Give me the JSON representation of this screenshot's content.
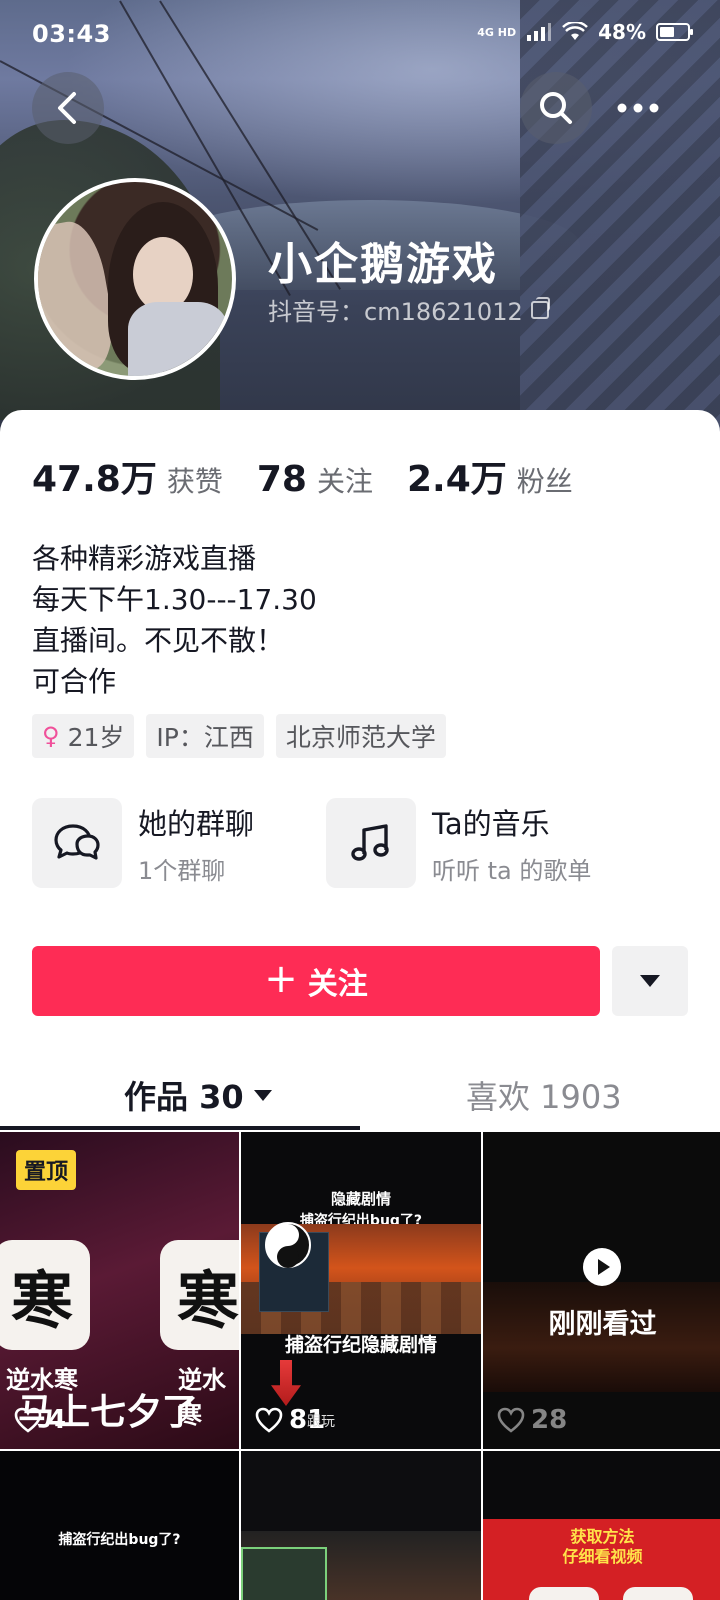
{
  "status_bar": {
    "time": "03:43",
    "network": "4G HD",
    "battery": "48%"
  },
  "profile": {
    "name": "小企鹅游戏",
    "handle": "抖音号：cm18621012"
  },
  "stats": [
    {
      "value": "47.8万",
      "label": "获赞"
    },
    {
      "value": "78",
      "label": "关注"
    },
    {
      "value": "2.4万",
      "label": "粉丝"
    }
  ],
  "bio": {
    "line1": "各种精彩游戏直播",
    "line2": "每天下午1.30---17.30",
    "line3": "直播间。不见不散！",
    "line4": "可合作"
  },
  "tags": {
    "age": "21岁",
    "ip": "IP：江西",
    "school": "北京师范大学"
  },
  "features": {
    "group_title": "她的群聊",
    "group_sub": "1个群聊",
    "music_title": "Ta的音乐",
    "music_sub": "听听 ta 的歌单"
  },
  "actions": {
    "follow": "关注"
  },
  "tabs": {
    "works": "作品 30",
    "likes": "喜欢 1903"
  },
  "grid": {
    "cell1": {
      "pin": "置顶",
      "app_glyph": "寒",
      "app_name_left": "逆水寒",
      "app_name_right": "逆水寒",
      "caption": "马上七夕了",
      "likes": "4"
    },
    "cell2": {
      "title_line1": "隐藏剧情",
      "title_line2": "捕盗行纪出bug了?",
      "subtitle": "捕盗行纪隐藏剧情",
      "likes": "81",
      "small_text": "跟玩"
    },
    "cell3": {
      "label": "刚刚看过",
      "likes": "28"
    },
    "cell4": {
      "title": "捕盗行纪出bug了?"
    },
    "cell6": {
      "line1": "获取方法",
      "line2": "仔细看视频"
    }
  },
  "colors": {
    "accent": "#fe2c55",
    "pin_badge": "#fcd338"
  }
}
